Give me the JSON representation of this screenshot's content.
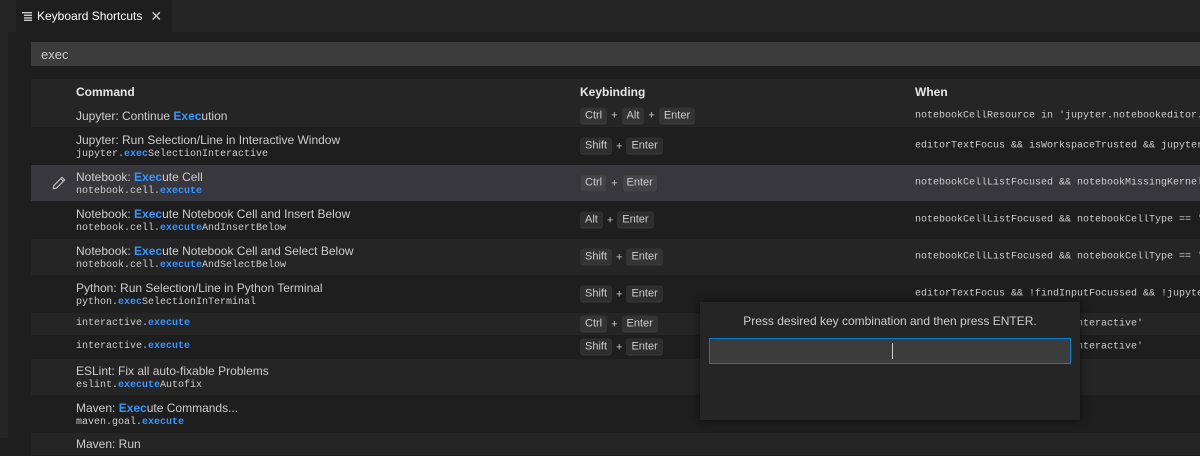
{
  "tab": {
    "label": "Keyboard Shortcuts",
    "close": "✕",
    "icon": "keyboard-shortcuts-icon"
  },
  "search": {
    "value": "exec",
    "placeholder": ""
  },
  "columns": {
    "command": "Command",
    "keybinding": "Keybinding",
    "when": "When"
  },
  "rows": [
    {
      "pre": "Jupyter: Continue ",
      "match": "Exec",
      "post": "ution",
      "id_pre": "",
      "id_match": "",
      "id_post": "",
      "keys": [
        "Ctrl",
        "Alt",
        "Enter"
      ],
      "when": "notebookCellResource in 'jupyter.notebookeditor.runallcells'"
    },
    {
      "pre": "Jupyter: Run Selection/Line in Interactive Window",
      "match": "",
      "post": "",
      "id_pre": "jupyter.",
      "id_match": "exec",
      "id_post": "SelectionInteractive",
      "keys": [
        "Shift",
        "Enter"
      ],
      "when": "editorTextFocus && isWorkspaceTrusted && jupyter.ownsSelection"
    },
    {
      "pre": "Notebook: ",
      "match": "Exec",
      "post": "ute Cell",
      "id_pre": "notebook.cell.",
      "id_match": "execute",
      "id_post": "",
      "keys": [
        "Ctrl",
        "Enter"
      ],
      "when": "notebookCellListFocused && notebookMissingKernelExtension"
    },
    {
      "pre": "Notebook: ",
      "match": "Exec",
      "post": "ute Notebook Cell and Insert Below",
      "id_pre": "notebook.cell.",
      "id_match": "execute",
      "id_post": "AndInsertBelow",
      "keys": [
        "Alt",
        "Enter"
      ],
      "when": "notebookCellListFocused && notebookCellType == 'markup'"
    },
    {
      "pre": "Notebook: ",
      "match": "Exec",
      "post": "ute Notebook Cell and Select Below",
      "id_pre": "notebook.cell.",
      "id_match": "execute",
      "id_post": "AndSelectBelow",
      "keys": [
        "Shift",
        "Enter"
      ],
      "when": "notebookCellListFocused && notebookCellType == 'markup'"
    },
    {
      "pre": "Python: Run Selection/Line in Python Terminal",
      "match": "",
      "post": "",
      "id_pre": "python.",
      "id_match": "exec",
      "id_post": "SelectionInTerminal",
      "keys": [
        "Shift",
        "Enter"
      ],
      "when": "editorTextFocus && !findInputFocussed && !jupyter.ownsSelection"
    },
    {
      "pre": "",
      "match": "",
      "post": "",
      "id_pre": "interactive.",
      "id_match": "execute",
      "id_post": "",
      "keys": [
        "Ctrl",
        "Enter"
      ],
      "when": "resourceScheme == 'vscode-interactive'"
    },
    {
      "pre": "",
      "match": "",
      "post": "",
      "id_pre": "interactive.",
      "id_match": "execute",
      "id_post": "",
      "keys": [
        "Shift",
        "Enter"
      ],
      "when": "resourceScheme == 'vscode-interactive'"
    },
    {
      "pre": "ESLint: Fix all auto-fixable Problems",
      "match": "",
      "post": "",
      "id_pre": "eslint.",
      "id_match": "execute",
      "id_post": "Autofix",
      "keys": [],
      "when": ""
    },
    {
      "pre": "Maven: ",
      "match": "Exec",
      "post": "ute Commands...",
      "id_pre": "maven.goal.",
      "id_match": "execute",
      "id_post": "",
      "keys": [],
      "when": ""
    },
    {
      "pre": "Maven: Run",
      "match": "",
      "post": "",
      "id_pre": "",
      "id_match": "",
      "id_post": "",
      "keys": [],
      "when": ""
    }
  ],
  "dialog": {
    "message": "Press desired key combination and then press ENTER.",
    "value": ""
  },
  "colors": {
    "highlight": "#3794ff",
    "focus_border": "#007fd4",
    "background": "#1e1e1e"
  }
}
